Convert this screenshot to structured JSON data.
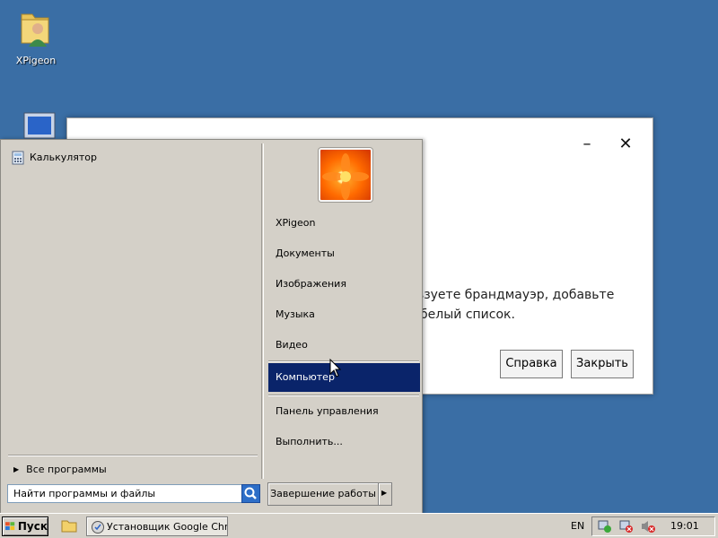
{
  "desktop": {
    "icons": [
      {
        "label": "XPigeon",
        "icon": "user-folder-icon"
      },
      {
        "label": "",
        "icon": "computer-icon"
      }
    ],
    "background_color": "#3a6ea5"
  },
  "dialog": {
    "minimize_glyph": "–",
    "close_glyph": "✕",
    "message_line1": "льзуете брандмауэр, добавьте",
    "message_line2": "о белый список.",
    "help_button": "Справка",
    "close_button": "Закрыть"
  },
  "start_menu": {
    "pinned_programs": [
      {
        "label": "Калькулятор",
        "icon": "calculator-icon"
      }
    ],
    "all_programs": "Все программы",
    "search_placeholder": "Найти программы и файлы",
    "user_avatar": "flower-avatar-icon",
    "right_items": [
      {
        "label": "XPigeon"
      },
      {
        "label": "Документы"
      },
      {
        "label": "Изображения"
      },
      {
        "label": "Музыка"
      },
      {
        "label": "Видео"
      },
      {
        "label": "Компьютер",
        "selected": true
      },
      {
        "label": "Панель управления"
      },
      {
        "label": "Выполнить..."
      }
    ],
    "shutdown_label": "Завершение работы",
    "selection_color": "#0a246a"
  },
  "taskbar": {
    "start_label": "Пуск",
    "quick_launch": "folder-icon",
    "task_button": "Установщик Google Chr...",
    "language": "EN",
    "clock": "19:01"
  }
}
